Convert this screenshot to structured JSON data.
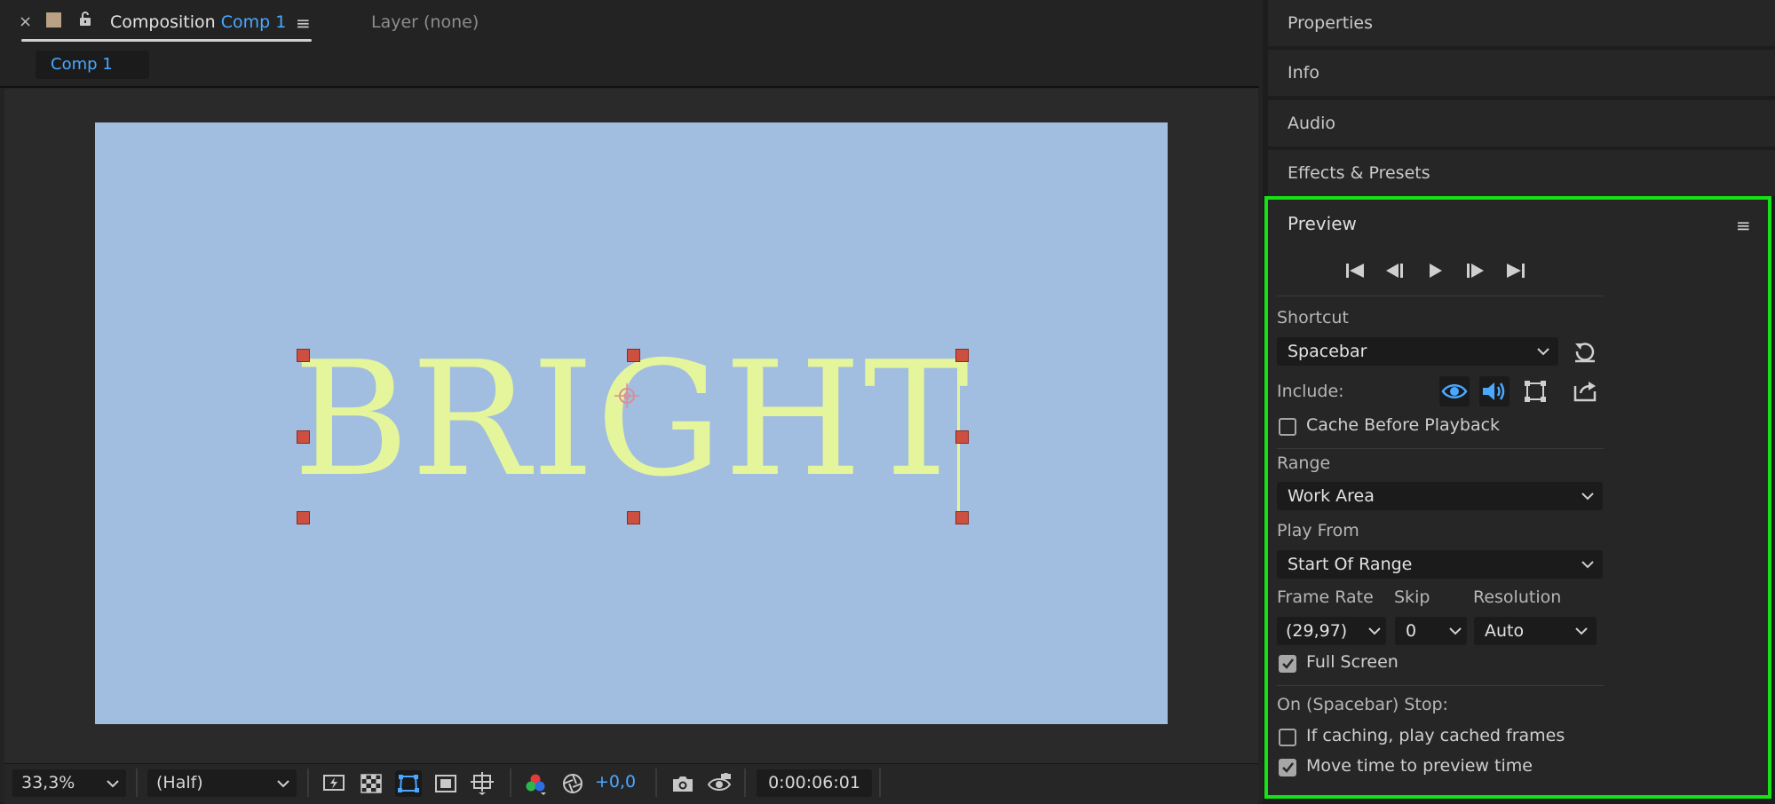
{
  "composition_panel": {
    "close_glyph": "×",
    "label": "Composition",
    "comp_name": "Comp 1",
    "menu_glyph": "≡",
    "layer_tab": "Layer (none)",
    "breadcrumb": "Comp 1"
  },
  "viewer": {
    "frame_color": "#a1bde0",
    "text": "BRIGHT",
    "text_color": "#e5f59c"
  },
  "toolbar": {
    "zoom": "33,3%",
    "resolution": "(Half)",
    "exposure": "+0,0",
    "timecode": "0:00:06:01"
  },
  "right_panels": {
    "properties": "Properties",
    "info": "Info",
    "audio": "Audio",
    "effects": "Effects & Presets"
  },
  "preview": {
    "title": "Preview",
    "menu_glyph": "≡",
    "shortcut_label": "Shortcut",
    "shortcut_value": "Spacebar",
    "include_label": "Include:",
    "cache_before_playback": "Cache Before Playback",
    "cache_before_playback_checked": false,
    "range_label": "Range",
    "range_value": "Work Area",
    "play_from_label": "Play From",
    "play_from_value": "Start Of Range",
    "frame_rate_label": "Frame Rate",
    "frame_rate_value": "(29,97)",
    "skip_label": "Skip",
    "skip_value": "0",
    "resolution_label": "Resolution",
    "resolution_value": "Auto",
    "full_screen": "Full Screen",
    "full_screen_checked": true,
    "stop_label": "On (Spacebar) Stop:",
    "if_caching": "If caching, play cached frames",
    "if_caching_checked": false,
    "move_time": "Move time to preview time",
    "move_time_checked": true
  },
  "colors": {
    "accent_blue": "#4aa8ff",
    "highlight_border": "#16e116",
    "handle": "#cc4f3f"
  }
}
